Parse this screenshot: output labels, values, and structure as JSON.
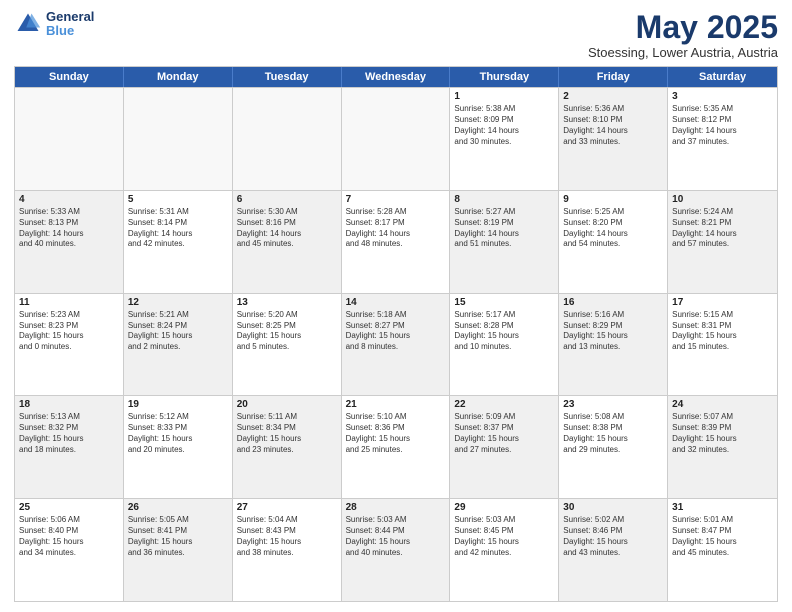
{
  "header": {
    "logo_line1": "General",
    "logo_line2": "Blue",
    "month": "May 2025",
    "location": "Stoessing, Lower Austria, Austria"
  },
  "days_of_week": [
    "Sunday",
    "Monday",
    "Tuesday",
    "Wednesday",
    "Thursday",
    "Friday",
    "Saturday"
  ],
  "rows": [
    [
      {
        "day": "",
        "text": "",
        "shaded": false,
        "empty": true
      },
      {
        "day": "",
        "text": "",
        "shaded": false,
        "empty": true
      },
      {
        "day": "",
        "text": "",
        "shaded": false,
        "empty": true
      },
      {
        "day": "",
        "text": "",
        "shaded": false,
        "empty": true
      },
      {
        "day": "1",
        "text": "Sunrise: 5:38 AM\nSunset: 8:09 PM\nDaylight: 14 hours\nand 30 minutes.",
        "shaded": false,
        "empty": false
      },
      {
        "day": "2",
        "text": "Sunrise: 5:36 AM\nSunset: 8:10 PM\nDaylight: 14 hours\nand 33 minutes.",
        "shaded": true,
        "empty": false
      },
      {
        "day": "3",
        "text": "Sunrise: 5:35 AM\nSunset: 8:12 PM\nDaylight: 14 hours\nand 37 minutes.",
        "shaded": false,
        "empty": false
      }
    ],
    [
      {
        "day": "4",
        "text": "Sunrise: 5:33 AM\nSunset: 8:13 PM\nDaylight: 14 hours\nand 40 minutes.",
        "shaded": true,
        "empty": false
      },
      {
        "day": "5",
        "text": "Sunrise: 5:31 AM\nSunset: 8:14 PM\nDaylight: 14 hours\nand 42 minutes.",
        "shaded": false,
        "empty": false
      },
      {
        "day": "6",
        "text": "Sunrise: 5:30 AM\nSunset: 8:16 PM\nDaylight: 14 hours\nand 45 minutes.",
        "shaded": true,
        "empty": false
      },
      {
        "day": "7",
        "text": "Sunrise: 5:28 AM\nSunset: 8:17 PM\nDaylight: 14 hours\nand 48 minutes.",
        "shaded": false,
        "empty": false
      },
      {
        "day": "8",
        "text": "Sunrise: 5:27 AM\nSunset: 8:19 PM\nDaylight: 14 hours\nand 51 minutes.",
        "shaded": true,
        "empty": false
      },
      {
        "day": "9",
        "text": "Sunrise: 5:25 AM\nSunset: 8:20 PM\nDaylight: 14 hours\nand 54 minutes.",
        "shaded": false,
        "empty": false
      },
      {
        "day": "10",
        "text": "Sunrise: 5:24 AM\nSunset: 8:21 PM\nDaylight: 14 hours\nand 57 minutes.",
        "shaded": true,
        "empty": false
      }
    ],
    [
      {
        "day": "11",
        "text": "Sunrise: 5:23 AM\nSunset: 8:23 PM\nDaylight: 15 hours\nand 0 minutes.",
        "shaded": false,
        "empty": false
      },
      {
        "day": "12",
        "text": "Sunrise: 5:21 AM\nSunset: 8:24 PM\nDaylight: 15 hours\nand 2 minutes.",
        "shaded": true,
        "empty": false
      },
      {
        "day": "13",
        "text": "Sunrise: 5:20 AM\nSunset: 8:25 PM\nDaylight: 15 hours\nand 5 minutes.",
        "shaded": false,
        "empty": false
      },
      {
        "day": "14",
        "text": "Sunrise: 5:18 AM\nSunset: 8:27 PM\nDaylight: 15 hours\nand 8 minutes.",
        "shaded": true,
        "empty": false
      },
      {
        "day": "15",
        "text": "Sunrise: 5:17 AM\nSunset: 8:28 PM\nDaylight: 15 hours\nand 10 minutes.",
        "shaded": false,
        "empty": false
      },
      {
        "day": "16",
        "text": "Sunrise: 5:16 AM\nSunset: 8:29 PM\nDaylight: 15 hours\nand 13 minutes.",
        "shaded": true,
        "empty": false
      },
      {
        "day": "17",
        "text": "Sunrise: 5:15 AM\nSunset: 8:31 PM\nDaylight: 15 hours\nand 15 minutes.",
        "shaded": false,
        "empty": false
      }
    ],
    [
      {
        "day": "18",
        "text": "Sunrise: 5:13 AM\nSunset: 8:32 PM\nDaylight: 15 hours\nand 18 minutes.",
        "shaded": true,
        "empty": false
      },
      {
        "day": "19",
        "text": "Sunrise: 5:12 AM\nSunset: 8:33 PM\nDaylight: 15 hours\nand 20 minutes.",
        "shaded": false,
        "empty": false
      },
      {
        "day": "20",
        "text": "Sunrise: 5:11 AM\nSunset: 8:34 PM\nDaylight: 15 hours\nand 23 minutes.",
        "shaded": true,
        "empty": false
      },
      {
        "day": "21",
        "text": "Sunrise: 5:10 AM\nSunset: 8:36 PM\nDaylight: 15 hours\nand 25 minutes.",
        "shaded": false,
        "empty": false
      },
      {
        "day": "22",
        "text": "Sunrise: 5:09 AM\nSunset: 8:37 PM\nDaylight: 15 hours\nand 27 minutes.",
        "shaded": true,
        "empty": false
      },
      {
        "day": "23",
        "text": "Sunrise: 5:08 AM\nSunset: 8:38 PM\nDaylight: 15 hours\nand 29 minutes.",
        "shaded": false,
        "empty": false
      },
      {
        "day": "24",
        "text": "Sunrise: 5:07 AM\nSunset: 8:39 PM\nDaylight: 15 hours\nand 32 minutes.",
        "shaded": true,
        "empty": false
      }
    ],
    [
      {
        "day": "25",
        "text": "Sunrise: 5:06 AM\nSunset: 8:40 PM\nDaylight: 15 hours\nand 34 minutes.",
        "shaded": false,
        "empty": false
      },
      {
        "day": "26",
        "text": "Sunrise: 5:05 AM\nSunset: 8:41 PM\nDaylight: 15 hours\nand 36 minutes.",
        "shaded": true,
        "empty": false
      },
      {
        "day": "27",
        "text": "Sunrise: 5:04 AM\nSunset: 8:43 PM\nDaylight: 15 hours\nand 38 minutes.",
        "shaded": false,
        "empty": false
      },
      {
        "day": "28",
        "text": "Sunrise: 5:03 AM\nSunset: 8:44 PM\nDaylight: 15 hours\nand 40 minutes.",
        "shaded": true,
        "empty": false
      },
      {
        "day": "29",
        "text": "Sunrise: 5:03 AM\nSunset: 8:45 PM\nDaylight: 15 hours\nand 42 minutes.",
        "shaded": false,
        "empty": false
      },
      {
        "day": "30",
        "text": "Sunrise: 5:02 AM\nSunset: 8:46 PM\nDaylight: 15 hours\nand 43 minutes.",
        "shaded": true,
        "empty": false
      },
      {
        "day": "31",
        "text": "Sunrise: 5:01 AM\nSunset: 8:47 PM\nDaylight: 15 hours\nand 45 minutes.",
        "shaded": false,
        "empty": false
      }
    ]
  ]
}
